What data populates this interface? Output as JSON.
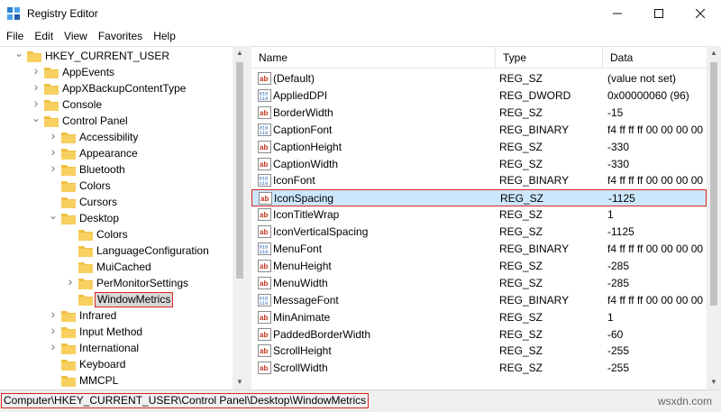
{
  "window": {
    "title": "Registry Editor"
  },
  "menu": [
    "File",
    "Edit",
    "View",
    "Favorites",
    "Help"
  ],
  "tree": [
    {
      "label": "HKEY_CURRENT_USER",
      "level": 0,
      "expanded": true
    },
    {
      "label": "AppEvents",
      "level": 1,
      "expanded": false
    },
    {
      "label": "AppXBackupContentType",
      "level": 1,
      "expanded": false
    },
    {
      "label": "Console",
      "level": 1,
      "expanded": false
    },
    {
      "label": "Control Panel",
      "level": 1,
      "expanded": true
    },
    {
      "label": "Accessibility",
      "level": 2,
      "expanded": false
    },
    {
      "label": "Appearance",
      "level": 2,
      "expanded": false
    },
    {
      "label": "Bluetooth",
      "level": 2,
      "expanded": false
    },
    {
      "label": "Colors",
      "level": 2,
      "expanded": null
    },
    {
      "label": "Cursors",
      "level": 2,
      "expanded": null
    },
    {
      "label": "Desktop",
      "level": 2,
      "expanded": true
    },
    {
      "label": "Colors",
      "level": 3,
      "expanded": null
    },
    {
      "label": "LanguageConfiguration",
      "level": 3,
      "expanded": null
    },
    {
      "label": "MuiCached",
      "level": 3,
      "expanded": null
    },
    {
      "label": "PerMonitorSettings",
      "level": 3,
      "expanded": false
    },
    {
      "label": "WindowMetrics",
      "level": 3,
      "expanded": null,
      "selected": true
    },
    {
      "label": "Infrared",
      "level": 2,
      "expanded": false
    },
    {
      "label": "Input Method",
      "level": 2,
      "expanded": false
    },
    {
      "label": "International",
      "level": 2,
      "expanded": false
    },
    {
      "label": "Keyboard",
      "level": 2,
      "expanded": null
    },
    {
      "label": "MMCPL",
      "level": 2,
      "expanded": null
    }
  ],
  "columns": {
    "name": "Name",
    "type": "Type",
    "data": "Data"
  },
  "values": [
    {
      "name": "(Default)",
      "type": "REG_SZ",
      "data": "(value not set)",
      "icon": "string-icon"
    },
    {
      "name": "AppliedDPI",
      "type": "REG_DWORD",
      "data": "0x00000060 (96)",
      "icon": "binary-icon"
    },
    {
      "name": "BorderWidth",
      "type": "REG_SZ",
      "data": "-15",
      "icon": "string-icon"
    },
    {
      "name": "CaptionFont",
      "type": "REG_BINARY",
      "data": "f4 ff ff ff 00 00 00 00",
      "icon": "binary-icon"
    },
    {
      "name": "CaptionHeight",
      "type": "REG_SZ",
      "data": "-330",
      "icon": "string-icon"
    },
    {
      "name": "CaptionWidth",
      "type": "REG_SZ",
      "data": "-330",
      "icon": "string-icon"
    },
    {
      "name": "IconFont",
      "type": "REG_BINARY",
      "data": "f4 ff ff ff 00 00 00 00",
      "icon": "binary-icon"
    },
    {
      "name": "IconSpacing",
      "type": "REG_SZ",
      "data": "-1125",
      "icon": "string-icon",
      "selected": true
    },
    {
      "name": "IconTitleWrap",
      "type": "REG_SZ",
      "data": "1",
      "icon": "string-icon"
    },
    {
      "name": "IconVerticalSpacing",
      "type": "REG_SZ",
      "data": "-1125",
      "icon": "string-icon"
    },
    {
      "name": "MenuFont",
      "type": "REG_BINARY",
      "data": "f4 ff ff ff 00 00 00 00",
      "icon": "binary-icon"
    },
    {
      "name": "MenuHeight",
      "type": "REG_SZ",
      "data": "-285",
      "icon": "string-icon"
    },
    {
      "name": "MenuWidth",
      "type": "REG_SZ",
      "data": "-285",
      "icon": "string-icon"
    },
    {
      "name": "MessageFont",
      "type": "REG_BINARY",
      "data": "f4 ff ff ff 00 00 00 00",
      "icon": "binary-icon"
    },
    {
      "name": "MinAnimate",
      "type": "REG_SZ",
      "data": "1",
      "icon": "string-icon"
    },
    {
      "name": "PaddedBorderWidth",
      "type": "REG_SZ",
      "data": "-60",
      "icon": "string-icon"
    },
    {
      "name": "ScrollHeight",
      "type": "REG_SZ",
      "data": "-255",
      "icon": "string-icon"
    },
    {
      "name": "ScrollWidth",
      "type": "REG_SZ",
      "data": "-255",
      "icon": "string-icon"
    }
  ],
  "status": {
    "path": "Computer\\HKEY_CURRENT_USER\\Control Panel\\Desktop\\WindowMetrics",
    "watermark": "wsxdn.com"
  },
  "colors": {
    "selection": "#cce8ff",
    "highlight_border": "#d9251d",
    "folder": "#f0c040"
  }
}
